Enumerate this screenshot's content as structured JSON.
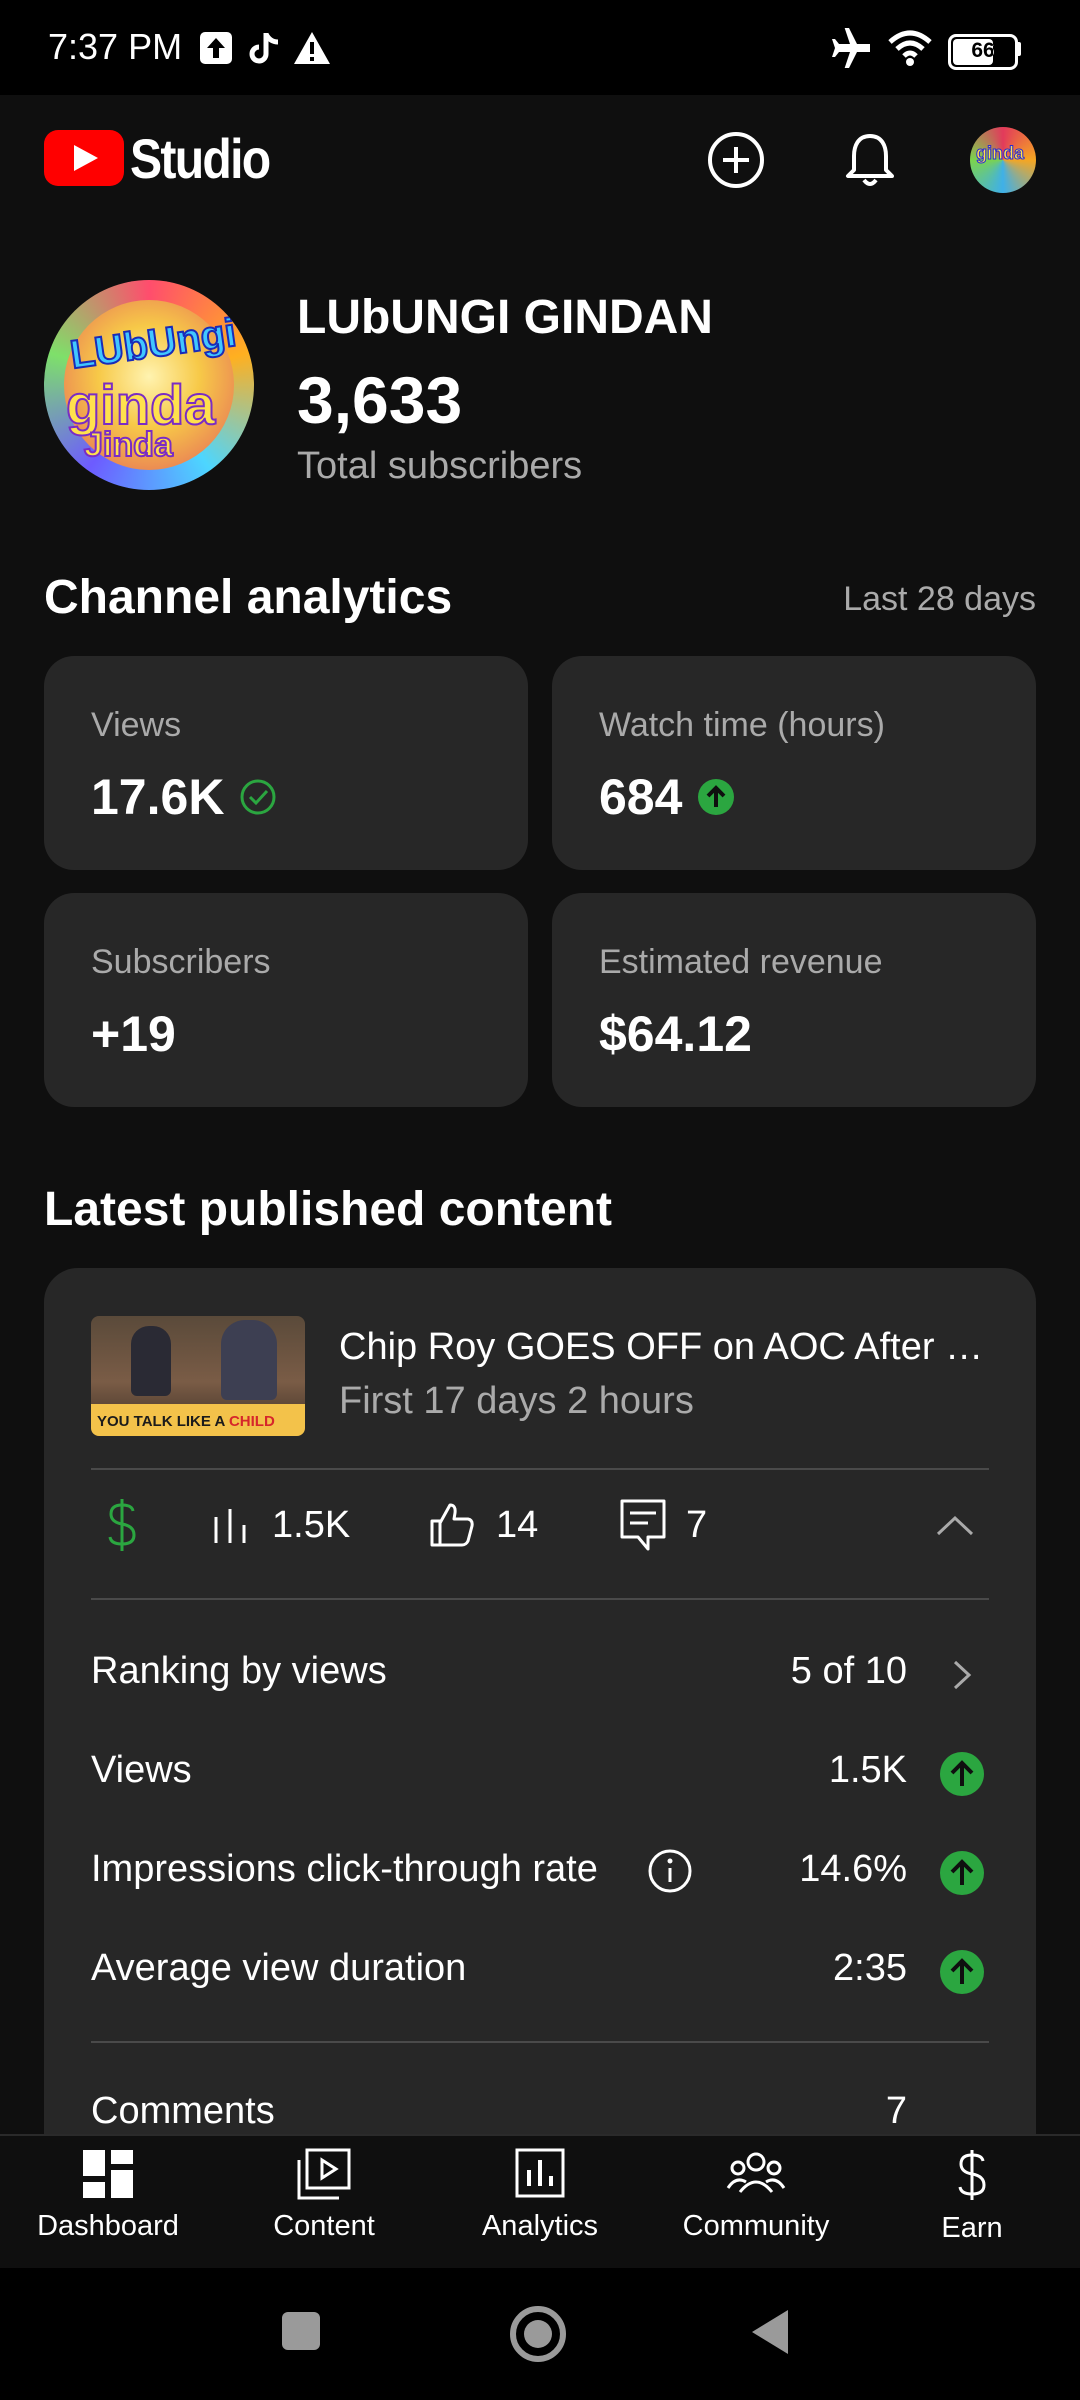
{
  "status_bar": {
    "time": "7:37 PM",
    "battery": "66"
  },
  "header": {
    "app_name": "Studio"
  },
  "channel": {
    "name": "LUbUNGI GINDAN",
    "subscriber_count": "3,633",
    "subscriber_label": "Total subscribers"
  },
  "analytics": {
    "title": "Channel analytics",
    "period": "Last 28 days",
    "cards": [
      {
        "label": "Views",
        "value": "17.6K",
        "indicator": "check-circle"
      },
      {
        "label": "Watch time (hours)",
        "value": "684",
        "indicator": "up-arrow"
      },
      {
        "label": "Subscribers",
        "value": "+19"
      },
      {
        "label": "Estimated revenue",
        "value": "$64.12"
      }
    ]
  },
  "latest": {
    "title": "Latest published content",
    "video": {
      "title": "Chip Roy GOES OFF on AOC After H…",
      "subtitle": "First 17 days 2 hours",
      "thumbnail_caption_a": "YOU TALK LIKE A ",
      "thumbnail_caption_b": "CHILD"
    },
    "stats": {
      "views": "1.5K",
      "likes": "14",
      "comments": "7"
    },
    "metrics": [
      {
        "name": "Ranking by views",
        "value": "5 of 10"
      },
      {
        "name": "Views",
        "value": "1.5K"
      },
      {
        "name": "Impressions click-through rate",
        "value": "14.6%"
      },
      {
        "name": "Average view duration",
        "value": "2:35"
      }
    ],
    "comments_row": {
      "name": "Comments",
      "value": "7"
    }
  },
  "bottom_nav": [
    "Dashboard",
    "Content",
    "Analytics",
    "Community",
    "Earn"
  ],
  "colors": {
    "background": "#0f0f0f",
    "card": "#272727",
    "accent_green": "#2ba640",
    "brand_red": "#ff0000"
  }
}
